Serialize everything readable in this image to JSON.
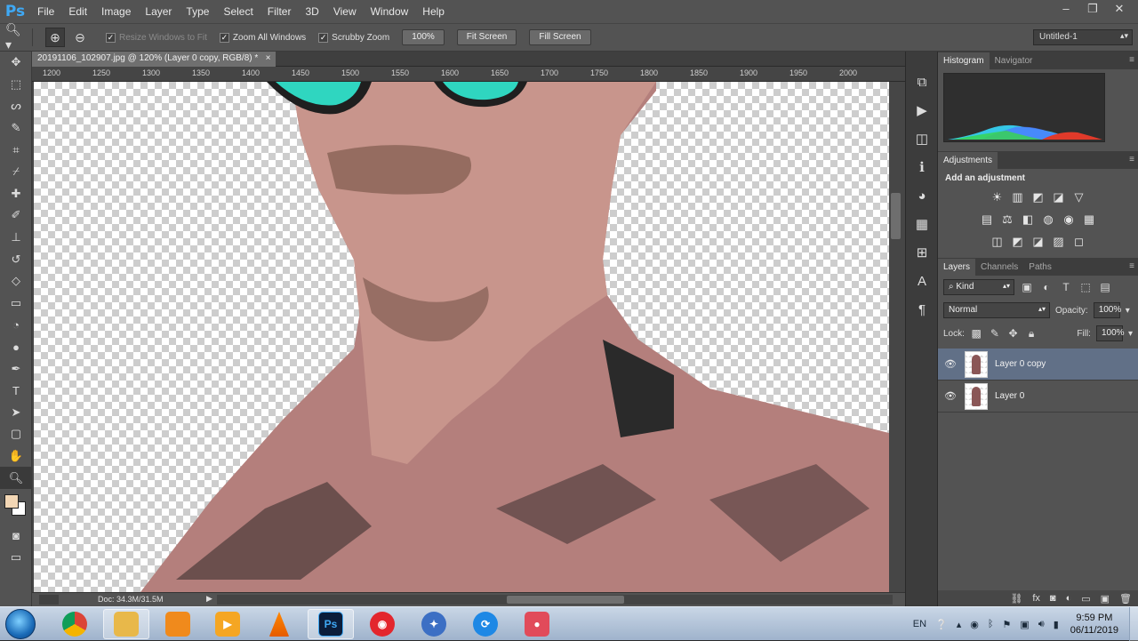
{
  "app": {
    "logo": "Ps",
    "menu": [
      "File",
      "Edit",
      "Image",
      "Layer",
      "Type",
      "Select",
      "Filter",
      "3D",
      "View",
      "Window",
      "Help"
    ],
    "window_controls": [
      "‒",
      "❐",
      "✕"
    ]
  },
  "options": {
    "tool_icon": "zoom-icon",
    "zoom_in_icon": "zoom-in-icon",
    "zoom_out_icon": "zoom-out-icon",
    "checkboxes": [
      {
        "label": "Resize Windows to Fit",
        "checked": true,
        "enabled": false
      },
      {
        "label": "Zoom All Windows",
        "checked": true,
        "enabled": true
      },
      {
        "label": "Scrubby Zoom",
        "checked": true,
        "enabled": true
      }
    ],
    "buttons": [
      "100%",
      "Fit Screen",
      "Fill Screen"
    ],
    "workspace": "Untitled-1"
  },
  "document": {
    "tab_title": "20191106_102907.jpg @ 120% (Layer 0 copy, RGB/8) *",
    "close": "×",
    "ruler_ticks": [
      "1200",
      "1250",
      "1300",
      "1350",
      "1400",
      "1450",
      "1500",
      "1550",
      "1600",
      "1650",
      "1700",
      "1750",
      "1800",
      "1850",
      "1900",
      "1950",
      "2000"
    ],
    "status_doc": "Doc: 34.3M/31.5M"
  },
  "panels": {
    "histogram_tabs": [
      "Histogram",
      "Navigator"
    ],
    "adjustments_tab": "Adjustments",
    "add_adjustment": "Add an adjustment",
    "adjust_icons_row1": [
      "☀",
      "▥",
      "◩",
      "◪",
      "▽"
    ],
    "adjust_icons_row2": [
      "▤",
      "⚖",
      "◧",
      "◍",
      "◉",
      "▦"
    ],
    "adjust_icons_row3": [
      "◫",
      "◩",
      "◪",
      "▨",
      "◻"
    ],
    "layers_tabs": [
      "Layers",
      "Channels",
      "Paths"
    ],
    "filter_kind": "Kind",
    "blend_mode": "Normal",
    "opacity_label": "Opacity:",
    "opacity": "100%",
    "lock_label": "Lock:",
    "fill_label": "Fill:",
    "fill": "100%",
    "layers": [
      {
        "name": "Layer 0 copy",
        "selected": true,
        "visible": true
      },
      {
        "name": "Layer 0",
        "selected": false,
        "visible": true
      }
    ],
    "footer_icons": [
      "⛓",
      "fx",
      "◙",
      "◐",
      "▭",
      "▣",
      "🗑"
    ]
  },
  "taskbar": {
    "apps": [
      "chrome",
      "file-explorer",
      "uc-browser",
      "media-player",
      "vlc",
      "photoshop",
      "screen-recorder",
      "app-globe",
      "sync-app",
      "camera-app"
    ],
    "photoshop_label": "Ps",
    "language": "EN",
    "time": "9:59 PM",
    "date": "06/11/2019"
  },
  "colors": {
    "foreground": "#f3d7b5",
    "background": "#ffffff",
    "selected_layer": "#617087",
    "ps_blue": "#3fa9f5"
  }
}
